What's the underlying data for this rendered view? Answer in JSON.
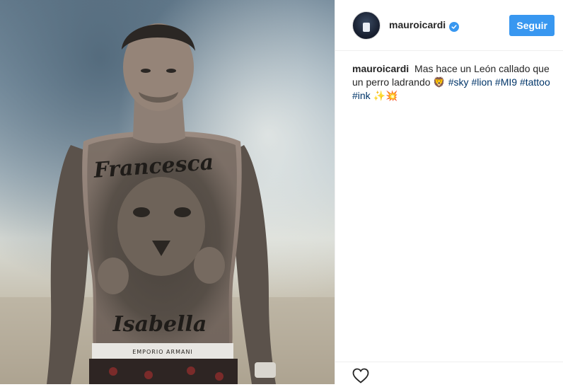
{
  "post": {
    "username": "mauroicardi",
    "follow_label": "Seguir",
    "caption": {
      "username": "mauroicardi",
      "text": "Mas hace un León callado que un perro ladrando",
      "lion_emoji": "🦁",
      "hashtags": [
        "#sky",
        "#lion",
        "#MI9",
        "#tattoo",
        "#ink"
      ],
      "trailing_emojis": [
        "✨",
        "💥"
      ]
    },
    "photo_texts": {
      "chest_tattoo": "Francesca",
      "belly_tattoo": "Isabella",
      "waistband": "EMPORIO ARMANI"
    }
  },
  "colors": {
    "follow_button": "#3897f0",
    "verified_badge": "#3897f0",
    "hashtag": "#003569",
    "text": "#262626",
    "border": "#efefef"
  },
  "icons": {
    "verified": "verified-badge-icon",
    "like": "heart-icon"
  }
}
